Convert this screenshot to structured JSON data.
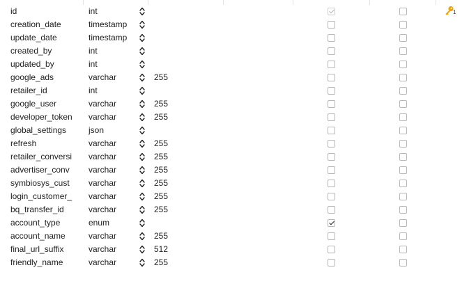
{
  "columns": [
    {
      "name": "id",
      "type": "int",
      "length": "",
      "not_null": true,
      "not_null_dim": true,
      "unsigned": false,
      "key": "1"
    },
    {
      "name": "creation_date",
      "type": "timestamp",
      "length": "",
      "not_null": false,
      "unsigned": false
    },
    {
      "name": "update_date",
      "type": "timestamp",
      "length": "",
      "not_null": false,
      "unsigned": false
    },
    {
      "name": "created_by",
      "type": "int",
      "length": "",
      "not_null": false,
      "unsigned": false
    },
    {
      "name": "updated_by",
      "type": "int",
      "length": "",
      "not_null": false,
      "unsigned": false
    },
    {
      "name": "google_ads",
      "type": "varchar",
      "length": "255",
      "not_null": false,
      "unsigned": false
    },
    {
      "name": "retailer_id",
      "type": "int",
      "length": "",
      "not_null": false,
      "unsigned": false
    },
    {
      "name": "google_user",
      "type": "varchar",
      "length": "255",
      "not_null": false,
      "unsigned": false
    },
    {
      "name": "developer_token",
      "type": "varchar",
      "length": "255",
      "not_null": false,
      "unsigned": false
    },
    {
      "name": "global_settings",
      "type": "json",
      "length": "",
      "not_null": false,
      "unsigned": false
    },
    {
      "name": "refresh",
      "type": "varchar",
      "length": "255",
      "not_null": false,
      "unsigned": false
    },
    {
      "name": "retailer_conversi",
      "type": "varchar",
      "length": "255",
      "not_null": false,
      "unsigned": false
    },
    {
      "name": "advertiser_conv",
      "type": "varchar",
      "length": "255",
      "not_null": false,
      "unsigned": false
    },
    {
      "name": "symbiosys_cust",
      "type": "varchar",
      "length": "255",
      "not_null": false,
      "unsigned": false
    },
    {
      "name": "login_customer_",
      "type": "varchar",
      "length": "255",
      "not_null": false,
      "unsigned": false
    },
    {
      "name": "bq_transfer_id",
      "type": "varchar",
      "length": "255",
      "not_null": false,
      "unsigned": false
    },
    {
      "name": "account_type",
      "type": "enum",
      "length": "",
      "not_null": true,
      "unsigned": false
    },
    {
      "name": "account_name",
      "type": "varchar",
      "length": "255",
      "not_null": false,
      "unsigned": false
    },
    {
      "name": "final_url_suffix",
      "type": "varchar",
      "length": "512",
      "not_null": false,
      "unsigned": false
    },
    {
      "name": "friendly_name",
      "type": "varchar",
      "length": "255",
      "not_null": false,
      "unsigned": false
    }
  ],
  "colors": {
    "key_icon": "#f0a400",
    "checkbox_border": "#b7b7b7"
  },
  "icons": {
    "primary_key": "key-icon",
    "type_stepper": "up-down-chevron-icon"
  }
}
